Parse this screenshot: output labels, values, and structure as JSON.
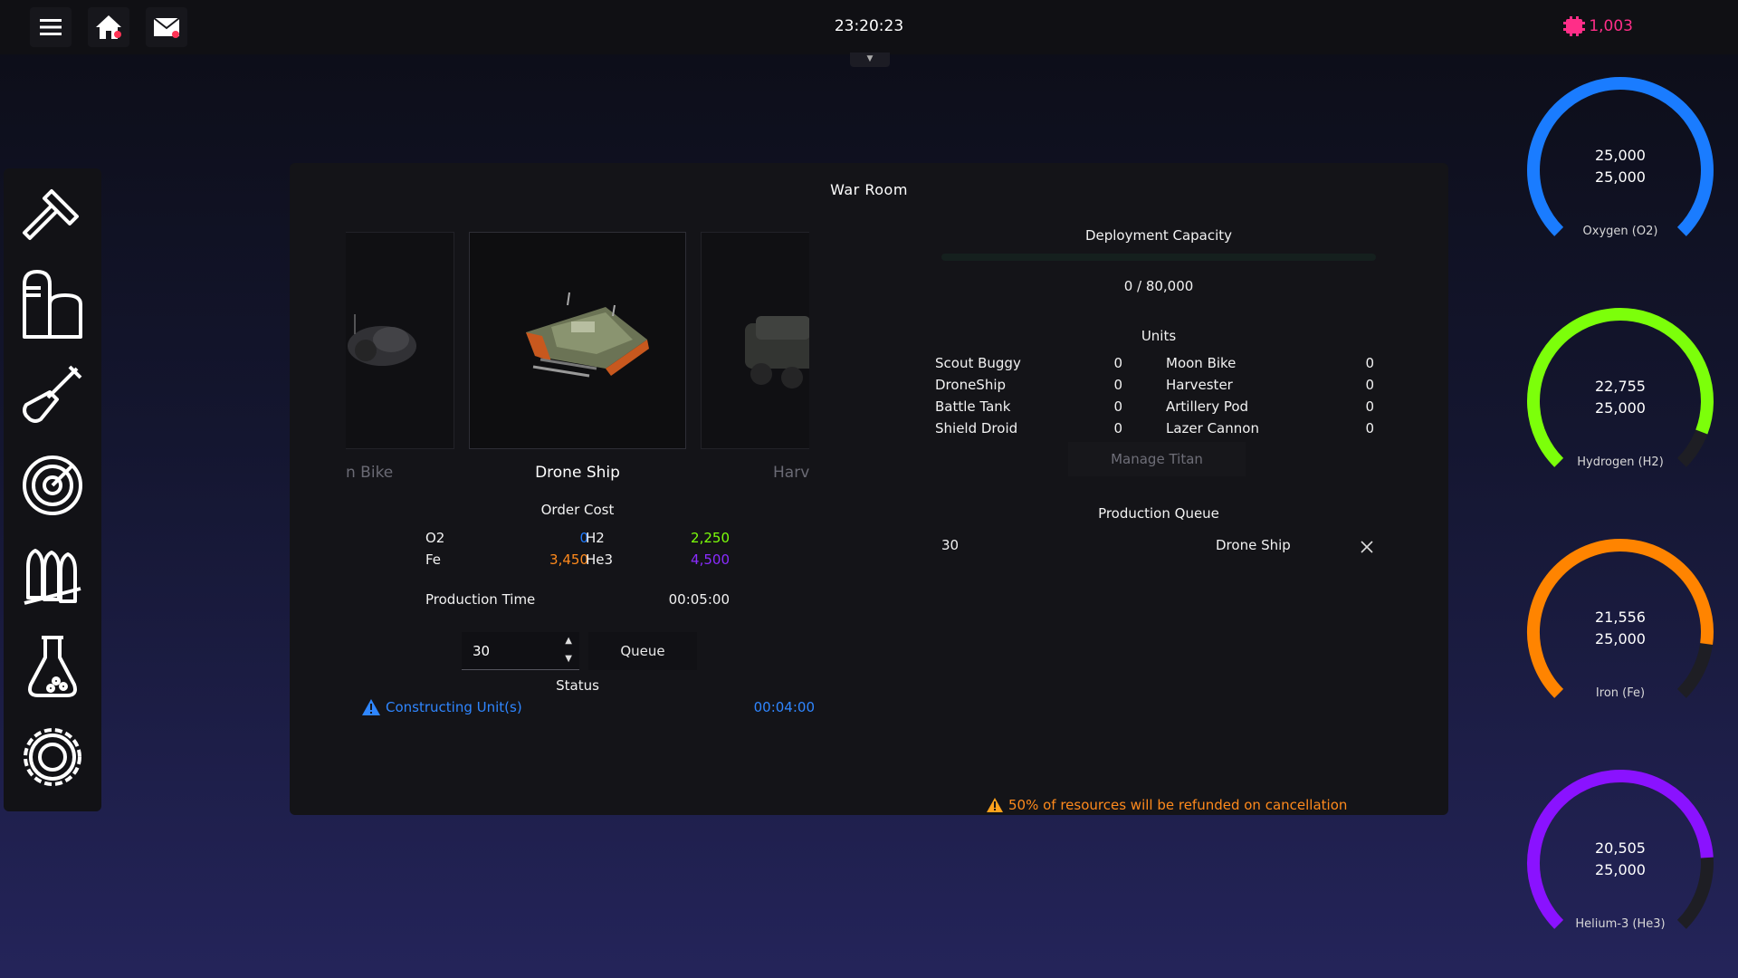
{
  "topbar": {
    "time": "23:20:23",
    "credits": "1,003",
    "credits_color": "#ff2e88"
  },
  "sidebar": {
    "items": [
      {
        "icon": "hammer-icon"
      },
      {
        "icon": "silo-icon"
      },
      {
        "icon": "shovel-icon"
      },
      {
        "icon": "radar-icon"
      },
      {
        "icon": "ammo-icon"
      },
      {
        "icon": "flask-icon"
      },
      {
        "icon": "settings-gear-icon"
      }
    ]
  },
  "panel": {
    "title": "War Room",
    "carousel": {
      "prev_label": "n Bike",
      "current_label": "Drone Ship",
      "next_label": "Harv"
    },
    "order_cost": {
      "title": "Order Cost",
      "o2_label": "O2",
      "o2_value": "0",
      "h2_label": "H2",
      "h2_value": "2,250",
      "fe_label": "Fe",
      "fe_value": "3,450",
      "he3_label": "He3",
      "he3_value": "4,500"
    },
    "production_time_label": "Production Time",
    "production_time_value": "00:05:00",
    "quantity": "30",
    "queue_button": "Queue",
    "status_title": "Status",
    "status_text": "Constructing Unit(s)",
    "status_time": "00:04:00",
    "deployment": {
      "title": "Deployment Capacity",
      "value": "0 / 80,000",
      "fraction": 0
    },
    "units": {
      "title": "Units",
      "left": [
        {
          "name": "Scout Buggy",
          "count": "0"
        },
        {
          "name": "DroneShip",
          "count": "0"
        },
        {
          "name": "Battle Tank",
          "count": "0"
        },
        {
          "name": "Shield Droid",
          "count": "0"
        }
      ],
      "right": [
        {
          "name": "Moon Bike",
          "count": "0"
        },
        {
          "name": "Harvester",
          "count": "0"
        },
        {
          "name": "Artillery Pod",
          "count": "0"
        },
        {
          "name": "Lazer Cannon",
          "count": "0"
        }
      ]
    },
    "manage_titan": "Manage Titan",
    "production_queue": {
      "title": "Production Queue",
      "items": [
        {
          "qty": "30",
          "name": "Drone Ship"
        }
      ]
    },
    "refund_warning": "50% of resources will be refunded on cancellation"
  },
  "gauges": [
    {
      "name": "Oxygen (O2)",
      "current": "25,000",
      "max": "25,000",
      "fraction": 1.0,
      "color": "#1a7cff"
    },
    {
      "name": "Hydrogen (H2)",
      "current": "22,755",
      "max": "25,000",
      "fraction": 0.9102,
      "color": "#7cff0a"
    },
    {
      "name": "Iron (Fe)",
      "current": "21,556",
      "max": "25,000",
      "fraction": 0.8622,
      "color": "#ff8400"
    },
    {
      "name": "Helium-3 (He3)",
      "current": "20,505",
      "max": "25,000",
      "fraction": 0.8202,
      "color": "#8a12ff"
    }
  ],
  "colors": {
    "o2": "#1f7bff",
    "h2": "#7cff0a",
    "fe": "#ff8a1c",
    "he3": "#8a2cff",
    "status": "#2f86ff",
    "warning": "#ff8a1c"
  }
}
